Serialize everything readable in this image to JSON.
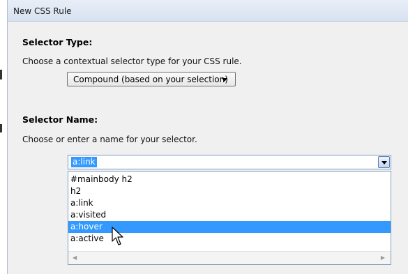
{
  "window": {
    "title": "New CSS Rule"
  },
  "selector_type": {
    "heading": "Selector Type:",
    "description": "Choose a contextual selector type for your CSS rule.",
    "selected": "Compound (based on your selection)"
  },
  "selector_name": {
    "heading": "Selector Name:",
    "description": "Choose or enter a name for your selector.",
    "value": "a:link",
    "options": [
      "#mainbody h2",
      "h2",
      "a:link",
      "a:visited",
      "a:hover",
      "a:active"
    ],
    "highlighted": "a:hover"
  },
  "icons": {
    "dropdown": "chevron-down-icon",
    "scroll_left": "scroll-left-icon",
    "scroll_right": "scroll-right-icon",
    "cursor": "mouse-pointer-icon"
  },
  "colors": {
    "selection": "#3399ff",
    "dialog_bg": "#f0f0f0",
    "title_bg": "#dce6f3"
  }
}
